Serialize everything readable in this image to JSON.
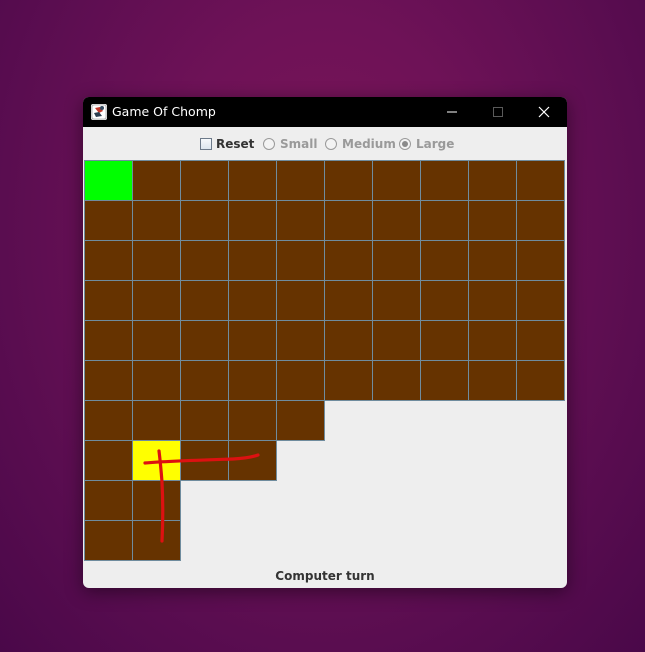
{
  "window": {
    "title": "Game Of Chomp",
    "app_icon": "chomp-app-icon"
  },
  "controls": {
    "reset_label": "Reset",
    "reset_checked": false,
    "size_options": [
      {
        "label": "Small",
        "selected": false,
        "enabled": false
      },
      {
        "label": "Medium",
        "selected": false,
        "enabled": false
      },
      {
        "label": "Large",
        "selected": true,
        "enabled": false
      }
    ]
  },
  "board": {
    "columns": 10,
    "row_lengths": [
      10,
      10,
      10,
      10,
      10,
      10,
      5,
      4,
      2,
      2
    ],
    "poison_cell": {
      "row": 0,
      "col": 0
    },
    "highlight_cell": {
      "row": 7,
      "col": 1
    },
    "colors": {
      "chocolate": "#663300",
      "poison": "#00ff00",
      "highlight": "#ffff00",
      "grid_line": "#6f8c9e",
      "annotation_stroke": "#dd1111"
    }
  },
  "status": "Computer turn"
}
